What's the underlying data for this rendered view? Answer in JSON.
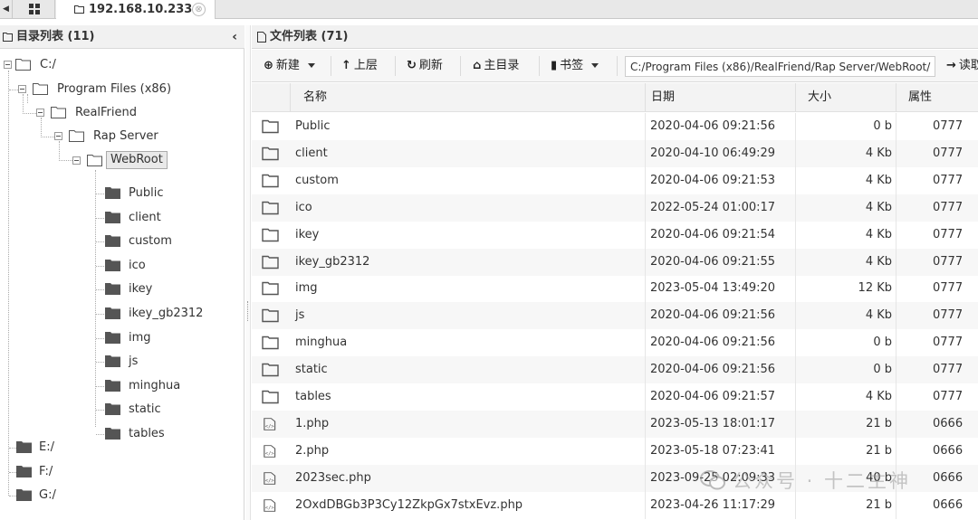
{
  "tabs": {
    "active_tab_label": "192.168.10.233",
    "close_glyph": "⊗"
  },
  "left_panel": {
    "title": "目录列表 (11)",
    "collapse_glyph": "‹",
    "tree": {
      "drive_c": "C:/",
      "program_files": "Program Files (x86)",
      "realfriend": "RealFriend",
      "rap_server": "Rap Server",
      "webroot": "WebRoot",
      "children": [
        "Public",
        "client",
        "custom",
        "ico",
        "ikey",
        "ikey_gb2312",
        "img",
        "js",
        "minghua",
        "static",
        "tables"
      ],
      "drive_e": "E:/",
      "drive_f": "F:/",
      "drive_g": "G:/"
    }
  },
  "right_panel": {
    "title": "文件列表 (71)",
    "toolbar": {
      "new_label": "新建",
      "up_label": "上层",
      "refresh_label": "刷新",
      "home_label": "主目录",
      "bookmark_label": "书签",
      "path_value": "C:/Program Files (x86)/RealFriend/Rap Server/WebRoot/",
      "read_label": "读取"
    },
    "columns": {
      "name": "名称",
      "date": "日期",
      "size": "大小",
      "attr": "属性"
    },
    "files": [
      {
        "name": "Public",
        "date": "2020-04-06 09:21:56",
        "size": "0 b",
        "attr": "0777",
        "kind": "folder"
      },
      {
        "name": "client",
        "date": "2020-04-10 06:49:29",
        "size": "4 Kb",
        "attr": "0777",
        "kind": "folder"
      },
      {
        "name": "custom",
        "date": "2020-04-06 09:21:53",
        "size": "4 Kb",
        "attr": "0777",
        "kind": "folder"
      },
      {
        "name": "ico",
        "date": "2022-05-24 01:00:17",
        "size": "4 Kb",
        "attr": "0777",
        "kind": "folder"
      },
      {
        "name": "ikey",
        "date": "2020-04-06 09:21:54",
        "size": "4 Kb",
        "attr": "0777",
        "kind": "folder"
      },
      {
        "name": "ikey_gb2312",
        "date": "2020-04-06 09:21:55",
        "size": "4 Kb",
        "attr": "0777",
        "kind": "folder"
      },
      {
        "name": "img",
        "date": "2023-05-04 13:49:20",
        "size": "12 Kb",
        "attr": "0777",
        "kind": "folder"
      },
      {
        "name": "js",
        "date": "2020-04-06 09:21:56",
        "size": "4 Kb",
        "attr": "0777",
        "kind": "folder"
      },
      {
        "name": "minghua",
        "date": "2020-04-06 09:21:56",
        "size": "0 b",
        "attr": "0777",
        "kind": "folder"
      },
      {
        "name": "static",
        "date": "2020-04-06 09:21:56",
        "size": "0 b",
        "attr": "0777",
        "kind": "folder"
      },
      {
        "name": "tables",
        "date": "2020-04-06 09:21:57",
        "size": "4 Kb",
        "attr": "0777",
        "kind": "folder"
      },
      {
        "name": "1.php",
        "date": "2023-05-13 18:01:17",
        "size": "21 b",
        "attr": "0666",
        "kind": "code"
      },
      {
        "name": "2.php",
        "date": "2023-05-18 07:23:41",
        "size": "21 b",
        "attr": "0666",
        "kind": "code"
      },
      {
        "name": "2023sec.php",
        "date": "2023-09-25 02:09:33",
        "size": "40 b",
        "attr": "0666",
        "kind": "code"
      },
      {
        "name": "2OxdDBGb3P3Cy12ZkpGx7stxEvz.php",
        "date": "2023-04-26 11:17:29",
        "size": "21 b",
        "attr": "0666",
        "kind": "code"
      }
    ]
  },
  "watermark": {
    "text": "公众号 · 十二主神"
  },
  "colors": {
    "header_bg": "#f1f1f1",
    "row_alt_bg": "#f7f7f7",
    "border": "#d9d9d9",
    "text": "#333333",
    "icon": "#555555"
  }
}
